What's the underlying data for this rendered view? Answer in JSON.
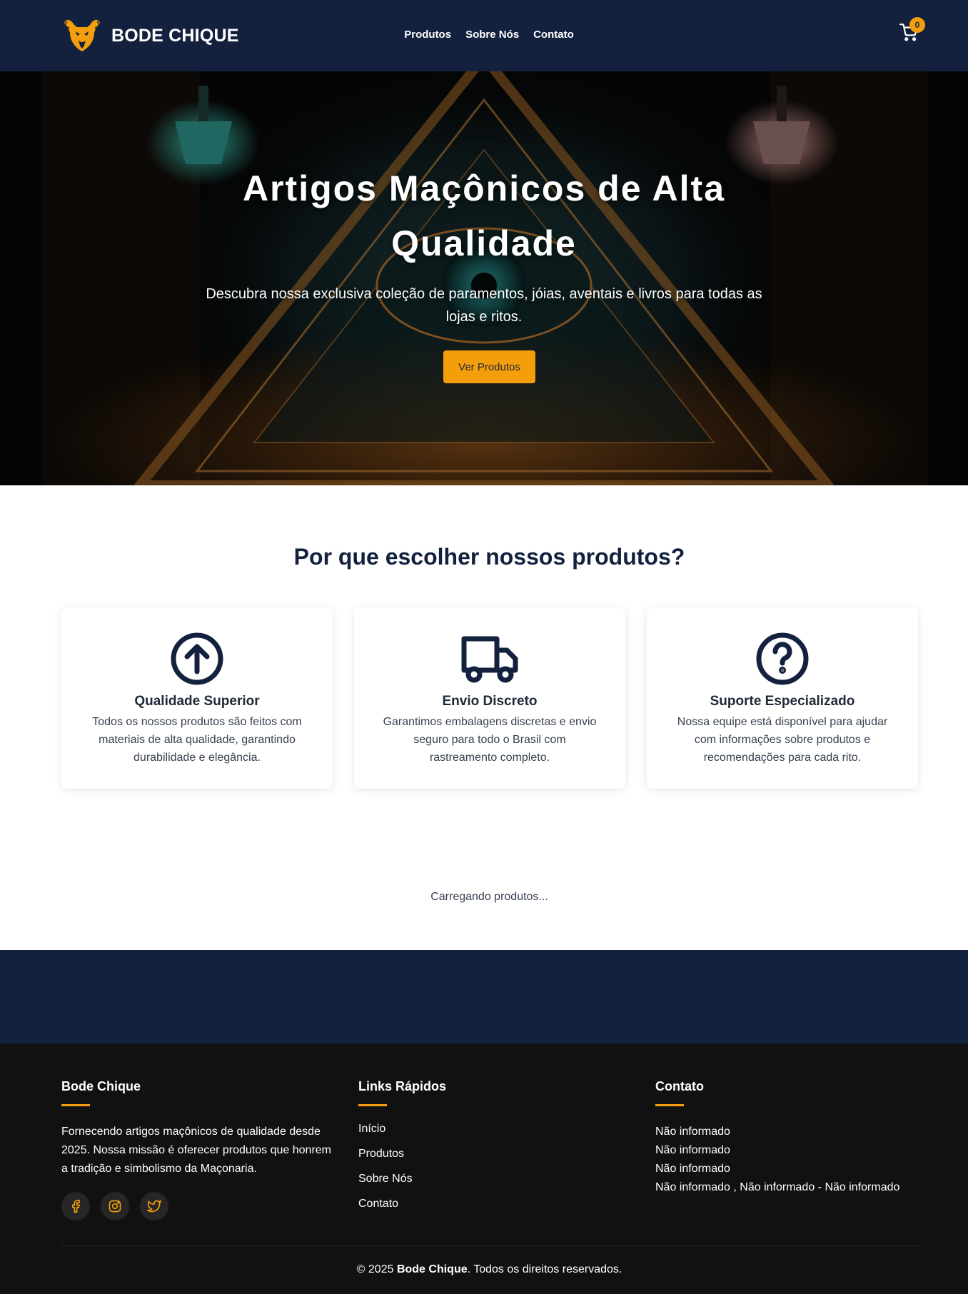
{
  "colors": {
    "navy": "#13213f",
    "accent": "#f59e0b",
    "footer_bg": "#111111"
  },
  "header": {
    "brand_name": "BODE CHIQUE",
    "logo_icon": "goat-head-logo",
    "nav": [
      {
        "label": "Produtos"
      },
      {
        "label": "Sobre Nós"
      },
      {
        "label": "Contato"
      }
    ],
    "cart_icon": "cart-icon",
    "cart_count": "0"
  },
  "hero": {
    "title": "Artigos Maçônicos de Alta Qualidade",
    "subtitle": "Descubra nossa exclusiva coleção de paramentos, jóias, aventais e livros para todas as lojas e ritos.",
    "button_label": "Ver Produtos"
  },
  "features": {
    "title": "Por que escolher nossos produtos?",
    "cards": [
      {
        "icon": "arrow-up-circle-icon",
        "title": "Qualidade Superior",
        "text": "Todos os nossos produtos são feitos com materiais de alta qualidade, garantindo durabilidade e elegância."
      },
      {
        "icon": "truck-icon",
        "title": "Envio Discreto",
        "text": "Garantimos embalagens discretas e envio seguro para todo o Brasil com rastreamento completo."
      },
      {
        "icon": "question-circle-icon",
        "title": "Suporte Especializado",
        "text": "Nossa equipe está disponível para ajudar com informações sobre produtos e recomendações para cada rito."
      }
    ]
  },
  "products": {
    "loading_text": "Carregando produtos..."
  },
  "footer": {
    "about_title": "Bode Chique",
    "about_text": "Fornecendo artigos maçônicos de qualidade desde 2025. Nossa missão é oferecer produtos que honrem a tradição e simbolismo da Maçonaria.",
    "socials": [
      "facebook-icon",
      "instagram-icon",
      "twitter-icon"
    ],
    "links_title": "Links Rápidos",
    "links": [
      "Início",
      "Produtos",
      "Sobre Nós",
      "Contato"
    ],
    "contact_title": "Contato",
    "contact": [
      "Não informado",
      "Não informado",
      "Não informado",
      "Não informado , Não informado - Não informado"
    ],
    "copyright_prefix": "© 2025 ",
    "copyright_brand": "Bode Chique",
    "copyright_suffix": ". Todos os direitos reservados."
  }
}
